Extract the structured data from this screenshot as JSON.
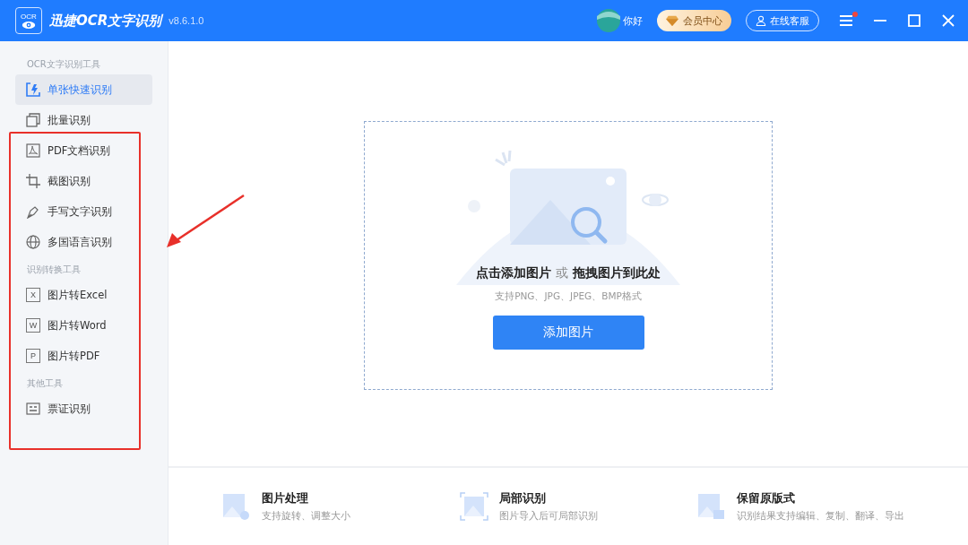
{
  "app": {
    "logo_text": "OCR",
    "title": "迅捷OCR文字识别",
    "version": "v8.6.1.0"
  },
  "header": {
    "greeting": "你好",
    "vip_button": "会员中心",
    "service_button": "在线客服",
    "menu_notification": true
  },
  "sidebar": {
    "sections": [
      {
        "heading": "OCR文字识别工具",
        "items": [
          {
            "label": "单张快速识别",
            "kind": "quick",
            "selected": true
          },
          {
            "label": "批量识别",
            "kind": "batch",
            "selected": false
          },
          {
            "label": "PDF文档识别",
            "kind": "pdf",
            "selected": false
          },
          {
            "label": "截图识别",
            "kind": "crop",
            "selected": false
          },
          {
            "label": "手写文字识别",
            "kind": "pen",
            "selected": false
          },
          {
            "label": "多国语言识别",
            "kind": "globe",
            "selected": false
          }
        ]
      },
      {
        "heading": "识别转换工具",
        "items": [
          {
            "label": "图片转Excel",
            "kind": "letter",
            "letter": "X",
            "selected": false
          },
          {
            "label": "图片转Word",
            "kind": "letter",
            "letter": "W",
            "selected": false
          },
          {
            "label": "图片转PDF",
            "kind": "letter",
            "letter": "P",
            "selected": false
          }
        ]
      },
      {
        "heading": "其他工具",
        "items": [
          {
            "label": "票证识别",
            "kind": "card",
            "selected": false
          }
        ]
      }
    ]
  },
  "dropzone": {
    "title_click": "点击添加图片",
    "title_or": "或",
    "title_drag": "拖拽图片到此处",
    "hint": "支持PNG、JPG、JPEG、BMP格式",
    "button": "添加图片"
  },
  "features": [
    {
      "title": "图片处理",
      "description": "支持旋转、调整大小",
      "kind": "rotate"
    },
    {
      "title": "局部识别",
      "description": "图片导入后可局部识别",
      "kind": "frame"
    },
    {
      "title": "保留原版式",
      "description": "识别结果支持编辑、复制、翻译、导出",
      "kind": "doc"
    }
  ]
}
